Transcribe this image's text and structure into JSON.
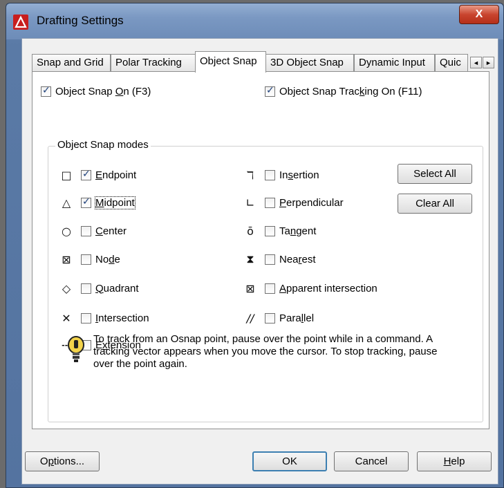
{
  "window": {
    "title": "Drafting Settings",
    "close_label": "X"
  },
  "tabs": [
    {
      "label": "Snap and Grid",
      "active": false
    },
    {
      "label": "Polar Tracking",
      "active": false
    },
    {
      "label": "Object Snap",
      "active": true
    },
    {
      "label": "3D Object Snap",
      "active": false
    },
    {
      "label": "Dynamic Input",
      "active": false
    },
    {
      "label": "Quic",
      "active": false
    }
  ],
  "tab_scroll": {
    "left": "◄",
    "right": "►"
  },
  "top_options": {
    "object_snap_on": {
      "pre": "Object Snap ",
      "key": "O",
      "post": "n (F3)",
      "checked": true
    },
    "tracking_on": {
      "pre": "Object Snap Trac",
      "key": "k",
      "post": "ing On (F11)",
      "checked": true
    }
  },
  "group": {
    "label": "Object Snap modes",
    "left_modes": [
      {
        "symbol": "□",
        "pre": "",
        "key": "E",
        "post": "ndpoint",
        "checked": true
      },
      {
        "symbol": "△",
        "pre": "",
        "key": "M",
        "post": "idpoint",
        "checked": true
      },
      {
        "symbol": "○",
        "pre": "",
        "key": "C",
        "post": "enter",
        "checked": false
      },
      {
        "symbol": "⊠",
        "pre": "No",
        "key": "d",
        "post": "e",
        "checked": false
      },
      {
        "symbol": "◇",
        "pre": "",
        "key": "Q",
        "post": "uadrant",
        "checked": false
      },
      {
        "symbol": "✕",
        "pre": "",
        "key": "I",
        "post": "ntersection",
        "checked": false
      },
      {
        "symbol": "---",
        "pre": "E",
        "key": "x",
        "post": "tension",
        "checked": false
      }
    ],
    "right_modes": [
      {
        "symbol": "ℸ",
        "pre": "In",
        "key": "s",
        "post": "ertion",
        "checked": false
      },
      {
        "symbol": "∟",
        "pre": "",
        "key": "P",
        "post": "erpendicular",
        "checked": false
      },
      {
        "symbol": "ō",
        "pre": "Ta",
        "key": "n",
        "post": "gent",
        "checked": false
      },
      {
        "symbol": "⧗",
        "pre": "Nea",
        "key": "r",
        "post": "est",
        "checked": false
      },
      {
        "symbol": "⊠",
        "pre": "",
        "key": "A",
        "post": "pparent intersection",
        "checked": false
      },
      {
        "symbol": "//",
        "pre": "Para",
        "key": "l",
        "post": "lel",
        "checked": false
      }
    ],
    "select_all_label": "Select All",
    "clear_all_label": "Clear All",
    "tip_text": "To track from an Osnap point, pause over the point while in a command.  A tracking vector appears when you move the cursor. To stop tracking, pause over the point again."
  },
  "footer": {
    "options": {
      "pre": "O",
      "key": "p",
      "post": "tions..."
    },
    "ok_label": "OK",
    "cancel_label": "Cancel",
    "help": {
      "pre": "",
      "key": "H",
      "post": "elp"
    }
  }
}
